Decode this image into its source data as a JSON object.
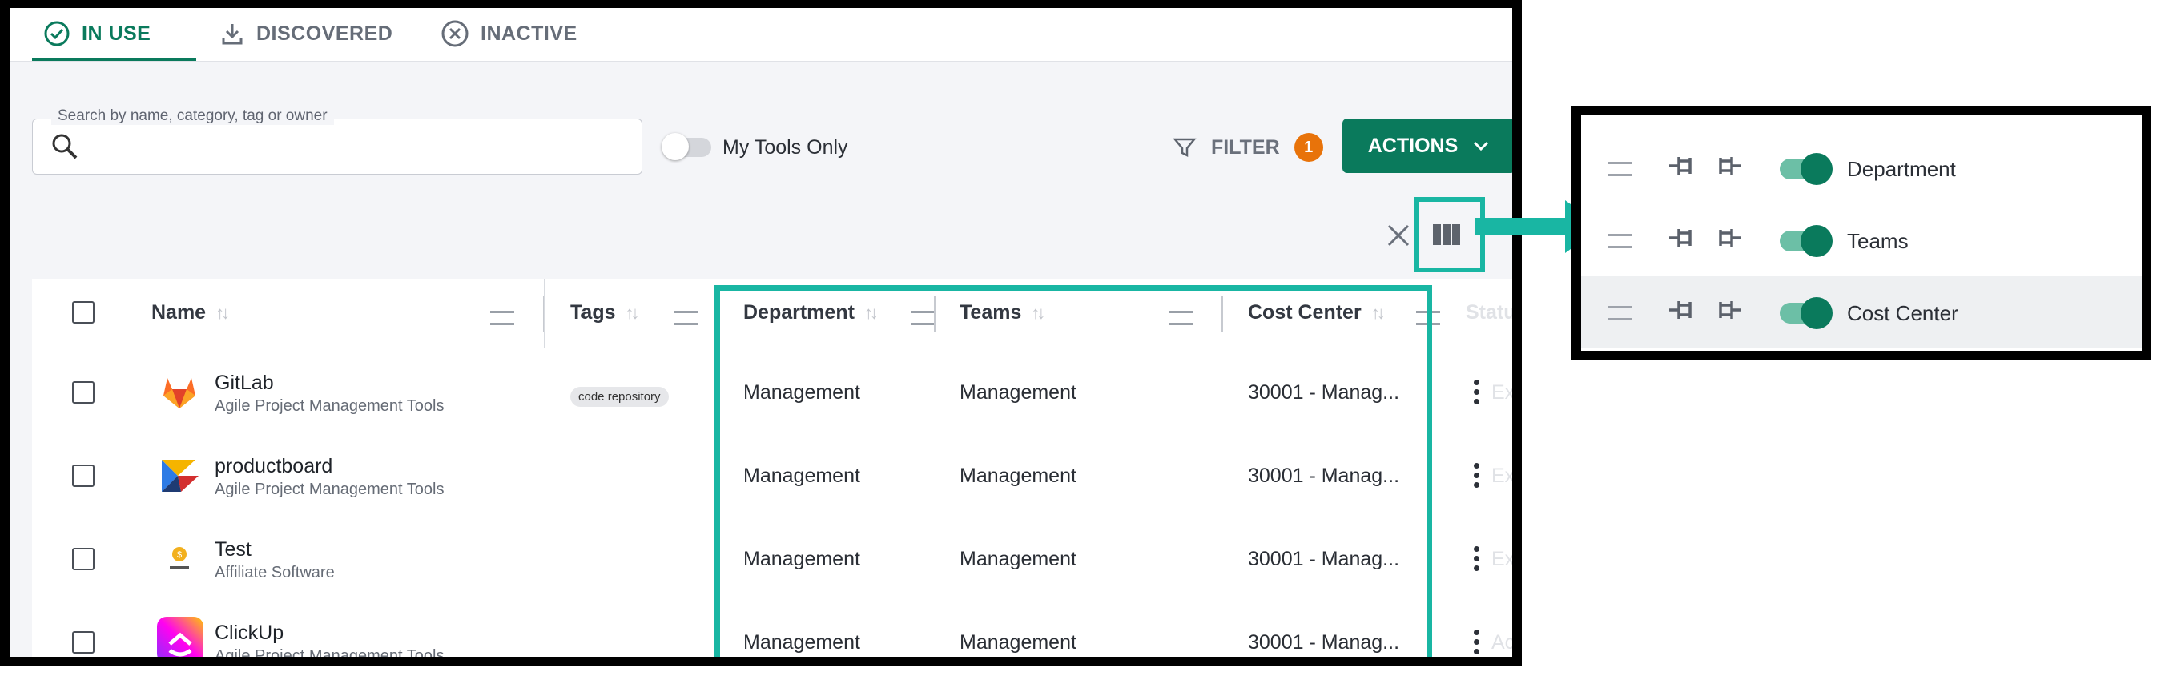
{
  "tabs": [
    {
      "label": "IN USE",
      "icon": "check-circle-icon",
      "active": true
    },
    {
      "label": "DISCOVERED",
      "icon": "download-icon",
      "active": false
    },
    {
      "label": "INACTIVE",
      "icon": "x-circle-icon",
      "active": false
    }
  ],
  "search": {
    "label": "Search by name, category, tag or owner",
    "placeholder": "",
    "value": ""
  },
  "my_tools": {
    "label": "My Tools Only",
    "on": false
  },
  "filter": {
    "label": "FILTER",
    "count": "1"
  },
  "actions": {
    "label": "ACTIONS"
  },
  "columns": {
    "name": "Name",
    "tags": "Tags",
    "department": "Department",
    "teams": "Teams",
    "cost_center": "Cost Center",
    "status_faded": "Statu"
  },
  "rows": [
    {
      "name": "GitLab",
      "category": "Agile Project Management Tools",
      "tag": "code repository",
      "department": "Management",
      "teams": "Management",
      "cost_center": "30001 - Manag...",
      "status_faded": "Exp"
    },
    {
      "name": "productboard",
      "category": "Agile Project Management Tools",
      "tag": "",
      "department": "Management",
      "teams": "Management",
      "cost_center": "30001 - Manag...",
      "status_faded": "Exp"
    },
    {
      "name": "Test",
      "category": "Affiliate Software",
      "tag": "",
      "department": "Management",
      "teams": "Management",
      "cost_center": "30001 - Manag...",
      "status_faded": "Exp"
    },
    {
      "name": "ClickUp",
      "category": "Agile Project Management Tools",
      "tag": "",
      "department": "Management",
      "teams": "Management",
      "cost_center": "30001 - Manag...",
      "status_faded": "Ac"
    }
  ],
  "panel": {
    "items": [
      {
        "label": "Department",
        "visible": true
      },
      {
        "label": "Teams",
        "visible": true
      },
      {
        "label": "Cost Center",
        "visible": true
      }
    ]
  },
  "colors": {
    "accent": "#0a7a5c",
    "highlight": "#19b6a3",
    "badge": "#e8730a"
  }
}
